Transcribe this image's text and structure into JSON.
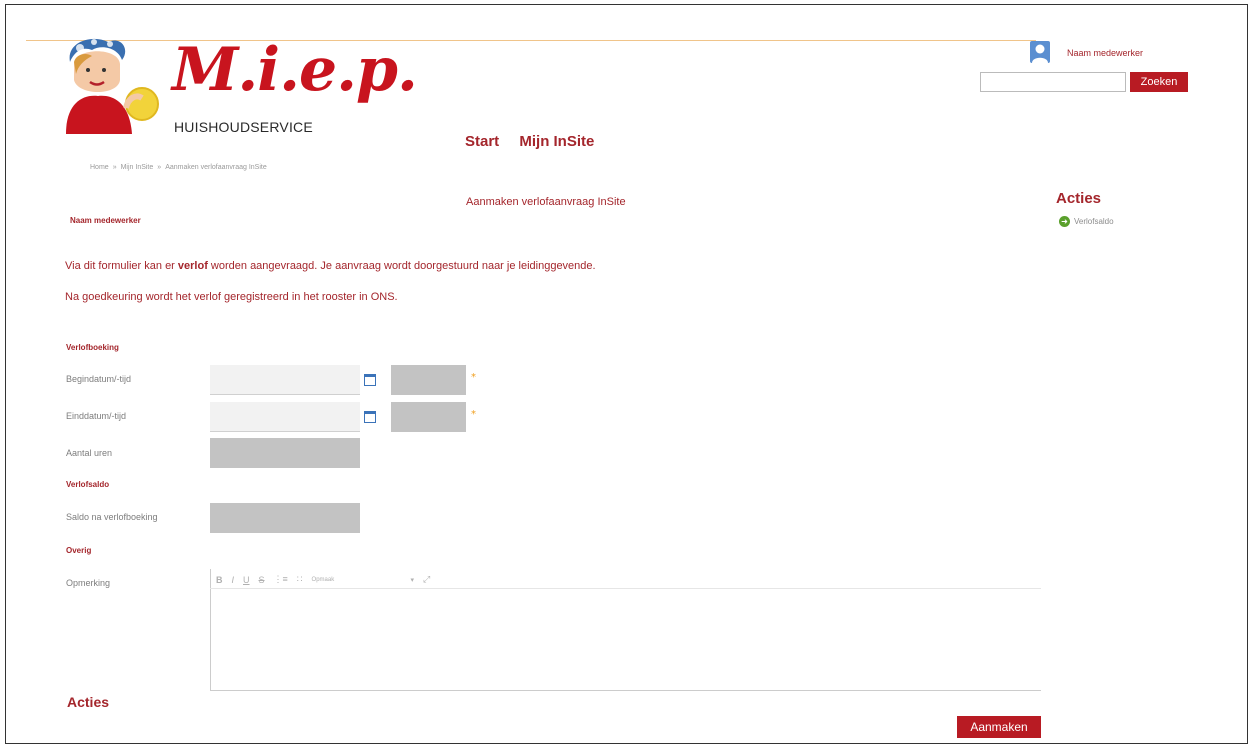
{
  "header": {
    "logo_text": "M.i.e.p.",
    "logo_subtitle": "HUISHOUDSERVICE",
    "user_name": "Naam medewerker",
    "search": {
      "placeholder": "",
      "button_label": "Zoeken"
    }
  },
  "nav": {
    "items": [
      "Start",
      "Mijn InSite"
    ]
  },
  "breadcrumb": {
    "items": [
      "Home",
      "Mijn InSite",
      "Aanmaken verlofaanvraag InSite"
    ],
    "separator": "»"
  },
  "page": {
    "title": "Aanmaken verlofaanvraag InSite",
    "employee": "Naam medewerker",
    "intro1_pre": "Via dit formulier kan er ",
    "intro1_bold": "verlof",
    "intro1_post": " worden aangevraagd. Je aanvraag wordt doorgestuurd naar je leidinggevende.",
    "intro2": "Na goedkeuring wordt het verlof geregistreerd in het rooster in ONS."
  },
  "sidebar": {
    "title": "Acties",
    "link_label": "Verlofsaldo"
  },
  "form": {
    "section_booking": "Verlofboeking",
    "label_start": "Begindatum/-tijd",
    "label_end": "Einddatum/-tijd",
    "label_hours": "Aantal uren",
    "section_balance": "Verlofsaldo",
    "label_balance": "Saldo na verlofboeking",
    "section_other": "Overig",
    "label_remark": "Opmerking",
    "required_mark": "*",
    "toolbar": {
      "bold": "B",
      "italic": "I",
      "underline": "U",
      "strike": "S",
      "ol": "⋮≡",
      "ul": "∷",
      "format": "Opmaak",
      "caret": "▾",
      "fullscreen": "⤢"
    }
  },
  "actions": {
    "title": "Acties",
    "create_label": "Aanmaken"
  },
  "colors": {
    "brand_red": "#b81b23",
    "text_red": "#a4262c",
    "required": "#f0a020",
    "calendar": "#3b73b9"
  }
}
